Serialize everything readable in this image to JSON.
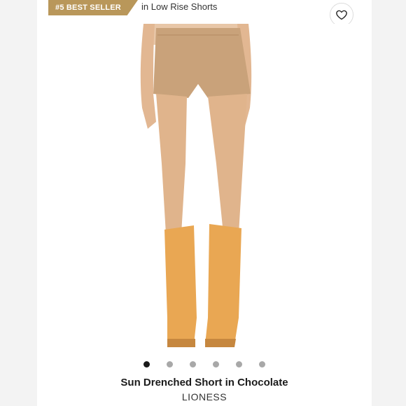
{
  "badge": {
    "label": "#5 BEST SELLER",
    "color": "#b9975a"
  },
  "category": "in Low Rise Shorts",
  "favorite": {
    "icon": "heart-icon"
  },
  "product": {
    "title": "Sun Drenched Short in Chocolate",
    "brand": "LIONESS"
  },
  "carousel": {
    "total": 6,
    "active": 1
  }
}
